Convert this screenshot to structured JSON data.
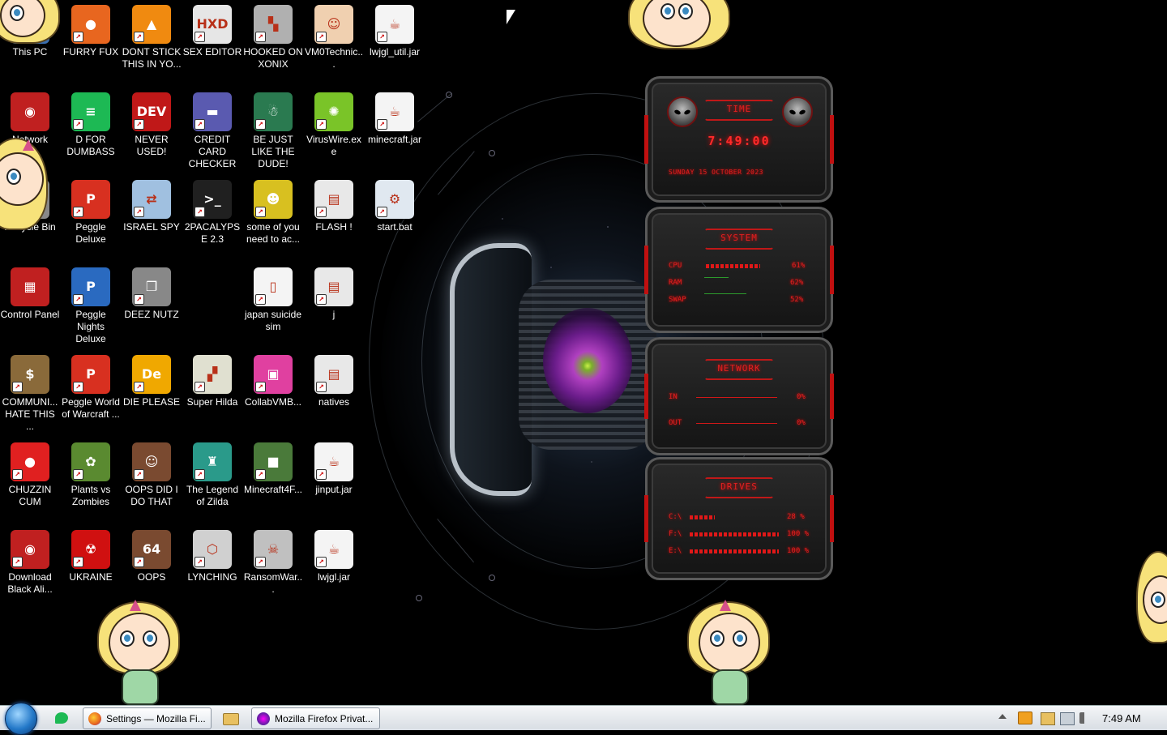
{
  "desktop": {
    "icons": [
      {
        "label": "This PC",
        "icon": "computer-icon",
        "color": "#3b6fb0"
      },
      {
        "label": "FURRY FUX",
        "icon": "firefox-icon",
        "color": "#e8661f"
      },
      {
        "label": "DONT STICK THIS IN YO...",
        "icon": "vlc-cone-icon",
        "color": "#f08a10"
      },
      {
        "label": "SEX EDITOR",
        "icon": "hxd-icon",
        "color": "#e6e6e6"
      },
      {
        "label": "HOOKED ON XONIX",
        "icon": "xonix-icon",
        "color": "#b0b0b0"
      },
      {
        "label": "VM0Technic...",
        "icon": "doctor-icon",
        "color": "#f0d0b0"
      },
      {
        "label": "lwjgl_util.jar",
        "icon": "java-jar-icon",
        "color": "#f4f4f4"
      },
      {
        "label": "Network",
        "icon": "network-alien-icon",
        "color": "#c02020"
      },
      {
        "label": "D FOR DUMBASS",
        "icon": "chat-bubble-icon",
        "color": "#1db954"
      },
      {
        "label": "NEVER USED!",
        "icon": "devcpp-icon",
        "color": "#c01818"
      },
      {
        "label": "CREDIT CARD CHECKER",
        "icon": "credit-card-icon",
        "color": "#5a5ab0"
      },
      {
        "label": "BE JUST LIKE THE DUDE!",
        "icon": "santa-icon",
        "color": "#2a7a50"
      },
      {
        "label": "VirusWire.exe",
        "icon": "lime-icon",
        "color": "#7ac428"
      },
      {
        "label": "minecraft.jar",
        "icon": "java-jar-icon",
        "color": "#f4f4f4"
      },
      {
        "label": "Recycle Bin",
        "icon": "recycle-bin-icon",
        "color": "#888888"
      },
      {
        "label": "Peggle Deluxe",
        "icon": "peggle-icon",
        "color": "#d83020"
      },
      {
        "label": "ISRAEL SPY",
        "icon": "spy-network-icon",
        "color": "#a0c0e0"
      },
      {
        "label": "2PACALYPSE 2.3",
        "icon": "console-icon",
        "color": "#202020"
      },
      {
        "label": "some of you need to ac...",
        "icon": "beaver-icon",
        "color": "#d8c020"
      },
      {
        "label": "FLASH !",
        "icon": "file-icon",
        "color": "#e8e8e8"
      },
      {
        "label": "start.bat",
        "icon": "gear-file-icon",
        "color": "#e0e8f0"
      },
      {
        "label": "Control Panel",
        "icon": "control-panel-icon",
        "color": "#c02020"
      },
      {
        "label": "Peggle Nights Deluxe",
        "icon": "peggle-nights-icon",
        "color": "#2a6ac0"
      },
      {
        "label": "DEEZ NUTZ",
        "icon": "stacked-windows-icon",
        "color": "#888888"
      },
      {
        "label": "japan suicide sim",
        "icon": "document-icon",
        "color": "#f4f4f4"
      },
      {
        "label": "j",
        "icon": "file-icon",
        "color": "#e8e8e8"
      },
      {
        "label": "COMMUNI... HATE THIS ...",
        "icon": "money-bag-icon",
        "color": "#8a6a3a"
      },
      {
        "label": "Peggle World of Warcraft ...",
        "icon": "peggle-icon",
        "color": "#d83020"
      },
      {
        "label": "DIE PLEASE",
        "icon": "adobe-de-icon",
        "color": "#f0a800"
      },
      {
        "label": "Super Hilda",
        "icon": "pixel-cat-icon",
        "color": "#e0e0d0"
      },
      {
        "label": "CollabVMB...",
        "icon": "collabvm-icon",
        "color": "#e040a0"
      },
      {
        "label": "natives",
        "icon": "file-icon",
        "color": "#e8e8e8"
      },
      {
        "label": "CHUZZIN CUM",
        "icon": "chuzzle-icon",
        "color": "#e02020"
      },
      {
        "label": "Plants vs Zombies",
        "icon": "plant-icon",
        "color": "#5a8a30"
      },
      {
        "label": "OOPS DID I DO THAT",
        "icon": "portrait-icon",
        "color": "#7a4a30"
      },
      {
        "label": "The Legend of Zilda",
        "icon": "zelda-icon",
        "color": "#2a9a8a"
      },
      {
        "label": "Minecraft4F...",
        "icon": "minecraft-block-icon",
        "color": "#4a7a3a"
      },
      {
        "label": "jinput.jar",
        "icon": "java-jar-icon",
        "color": "#f4f4f4"
      },
      {
        "label": "Download Black Ali...",
        "icon": "alien-head-icon",
        "color": "#c02020"
      },
      {
        "label": "UKRAINE",
        "icon": "radiation-icon",
        "color": "#d01010"
      },
      {
        "label": "OOPS",
        "icon": "portrait-64-icon",
        "color": "#7a4a30"
      },
      {
        "label": "LYNCHING",
        "icon": "rope-badge-icon",
        "color": "#d0d0d0"
      },
      {
        "label": "RansomWar...",
        "icon": "skull-icon",
        "color": "#c0c0c0"
      },
      {
        "label": "lwjgl.jar",
        "icon": "java-jar-icon",
        "color": "#f4f4f4"
      }
    ]
  },
  "widget": {
    "time_title": "TIME",
    "clock": "7:49:00",
    "date": "SUNDAY 15 OCTOBER 2023",
    "system_title": "SYSTEM",
    "cpu_label": "CPU",
    "cpu_value": "61%",
    "cpu_level": 0.61,
    "ram_label": "RAM",
    "ram_value": "62%",
    "swap_label": "SWAP",
    "swap_value": "52%",
    "network_title": "NETWORK",
    "in_label": "IN",
    "in_value": "0%",
    "out_label": "OUT",
    "out_value": "0%",
    "drives_title": "DRIVES",
    "drives": [
      {
        "label": "C:\\",
        "value": "28 %",
        "level": 0.28
      },
      {
        "label": "F:\\",
        "value": "100 %",
        "level": 1.0
      },
      {
        "label": "E:\\",
        "value": "100 %",
        "level": 1.0
      }
    ],
    "accent": "#e01818"
  },
  "taskbar": {
    "tasks": [
      {
        "label": "Settings — Mozilla Fi...",
        "icon": "firefox-icon"
      },
      {
        "label": "Mozilla Firefox Privat...",
        "icon": "firefox-private-icon"
      }
    ],
    "clock": "7:49 AM"
  }
}
